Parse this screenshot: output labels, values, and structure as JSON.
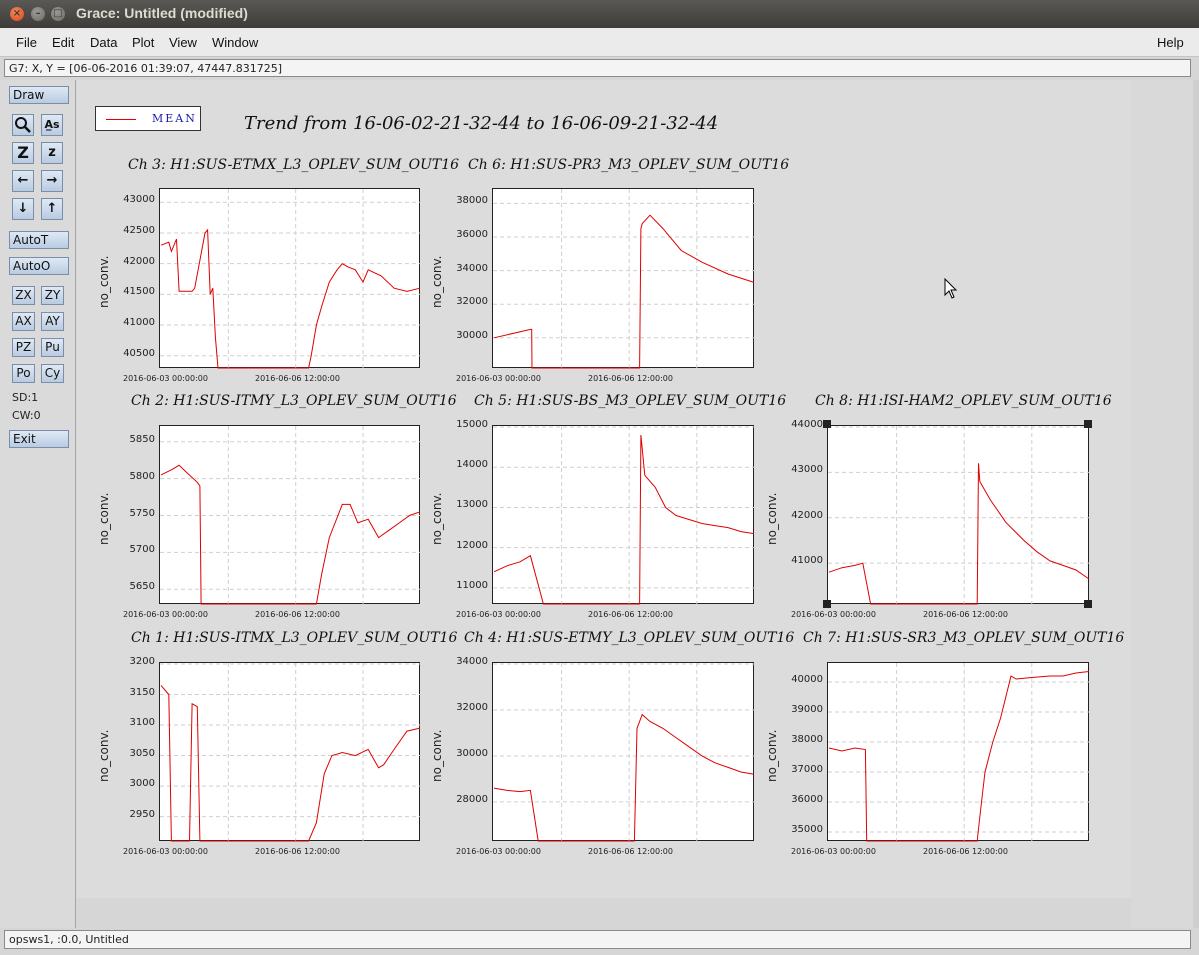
{
  "window": {
    "title": "Grace: Untitled (modified)"
  },
  "menu": {
    "file": "File",
    "edit": "Edit",
    "data": "Data",
    "plot": "Plot",
    "view": "View",
    "window": "Window",
    "help": "Help"
  },
  "locator": {
    "text": "G7: X, Y = [06-06-2016 01:39:07, 47447.831725]"
  },
  "toolbar": {
    "draw": "Draw",
    "autot": "AutoT",
    "autoo": "AutoO",
    "exit": "Exit",
    "zx": "ZX",
    "zy": "ZY",
    "ax": "AX",
    "ay": "AY",
    "pz": "PZ",
    "pu": "Pu",
    "po": "Po",
    "cy": "Cy",
    "sd": "SD:1",
    "cw": "CW:0",
    "z_big": "Z",
    "z_small": "z",
    "as": "A̲s"
  },
  "status": {
    "text": "opsws1, :0.0, Untitled"
  },
  "legend": {
    "label": "MEAN",
    "color": "#e00000"
  },
  "chart_title": "Trend from 16-06-02-21-32-44 to 16-06-09-21-32-44",
  "chart_data": [
    {
      "type": "line",
      "title": "Ch 3: H1:SUS-ETMX_L3_OPLEV_SUM_OUT16",
      "ylabel": "no_conv.",
      "ylim": [
        40300,
        43200
      ],
      "yticks": [
        40500,
        41000,
        41500,
        42000,
        42500,
        43000
      ],
      "xticks": [
        "2016-06-03 00:00:00",
        "2016-06-06 12:00:00"
      ],
      "x": [
        0,
        0.03,
        0.04,
        0.06,
        0.07,
        0.12,
        0.13,
        0.17,
        0.18,
        0.19,
        0.2,
        0.21,
        0.22,
        0.23,
        0.57,
        0.58,
        0.6,
        0.62,
        0.65,
        0.68,
        0.7,
        0.72,
        0.75,
        0.78,
        0.8,
        0.85,
        0.9,
        0.95,
        1.0
      ],
      "y": [
        42300,
        42350,
        42200,
        42400,
        41550,
        41550,
        41600,
        42500,
        42550,
        41500,
        41600,
        40800,
        40300,
        40300,
        40300,
        40500,
        41000,
        41300,
        41700,
        41900,
        42000,
        41950,
        41900,
        41700,
        41900,
        41800,
        41600,
        41550,
        41600
      ]
    },
    {
      "type": "line",
      "title": "Ch 6: H1:SUS-PR3_M3_OPLEV_SUM_OUT16",
      "ylabel": "no_conv.",
      "ylim": [
        28200,
        38800
      ],
      "yticks": [
        30000,
        32000,
        34000,
        36000,
        38000
      ],
      "xticks": [
        "2016-06-03 00:00:00",
        "2016-06-06 12:00:00"
      ],
      "x": [
        0,
        0.14,
        0.145,
        0.146,
        0.56,
        0.565,
        0.57,
        0.6,
        0.65,
        0.72,
        0.8,
        0.9,
        1.0
      ],
      "y": [
        30000,
        30500,
        30500,
        28200,
        28200,
        36500,
        36800,
        37300,
        36500,
        35200,
        34500,
        33800,
        33300
      ]
    },
    {
      "type": "line",
      "title": "Ch 2: H1:SUS-ITMY_L3_OPLEV_SUM_OUT16",
      "ylabel": "no_conv.",
      "ylim": [
        5630,
        5870
      ],
      "yticks": [
        5650,
        5700,
        5750,
        5800,
        5850
      ],
      "xticks": [
        "2016-06-03 00:00:00",
        "2016-06-06 12:00:00"
      ],
      "x": [
        0,
        0.04,
        0.07,
        0.1,
        0.14,
        0.15,
        0.155,
        0.6,
        0.62,
        0.65,
        0.7,
        0.73,
        0.76,
        0.8,
        0.84,
        0.88,
        0.92,
        0.96,
        1.0
      ],
      "y": [
        5805,
        5812,
        5818,
        5808,
        5795,
        5790,
        5630,
        5630,
        5670,
        5720,
        5765,
        5765,
        5740,
        5745,
        5720,
        5730,
        5740,
        5750,
        5755
      ]
    },
    {
      "type": "line",
      "title": "Ch 5: H1:SUS-BS_M3_OPLEV_SUM_OUT16",
      "ylabel": "no_conv.",
      "ylim": [
        10600,
        15000
      ],
      "yticks": [
        11000,
        12000,
        13000,
        14000,
        15000
      ],
      "xticks": [
        "2016-06-03 00:00:00",
        "2016-06-06 12:00:00"
      ],
      "x": [
        0,
        0.05,
        0.1,
        0.14,
        0.19,
        0.2,
        0.56,
        0.565,
        0.58,
        0.62,
        0.66,
        0.7,
        0.75,
        0.8,
        0.85,
        0.9,
        0.95,
        1.0
      ],
      "y": [
        11400,
        11550,
        11650,
        11800,
        10600,
        10600,
        10600,
        14800,
        13800,
        13500,
        13000,
        12800,
        12700,
        12600,
        12550,
        12500,
        12400,
        12350
      ]
    },
    {
      "type": "line",
      "title": "Ch 8: H1:ISI-HAM2_OPLEV_SUM_OUT16",
      "ylabel": "no_conv.",
      "ylim": [
        40100,
        44000
      ],
      "yticks": [
        41000,
        42000,
        43000,
        44000
      ],
      "xticks": [
        "2016-06-03 00:00:00",
        "2016-06-06 12:00:00"
      ],
      "x": [
        0,
        0.05,
        0.1,
        0.13,
        0.15,
        0.16,
        0.57,
        0.575,
        0.58,
        0.62,
        0.68,
        0.75,
        0.8,
        0.85,
        0.9,
        0.95,
        1.0
      ],
      "y": [
        40800,
        40900,
        40950,
        41000,
        40400,
        40100,
        40100,
        43200,
        42800,
        42400,
        41900,
        41500,
        41250,
        41050,
        40950,
        40850,
        40650
      ]
    },
    {
      "type": "line",
      "title": "Ch 1: H1:SUS-ITMX_L3_OPLEV_SUM_OUT16",
      "ylabel": "no_conv.",
      "ylim": [
        2910,
        3200
      ],
      "yticks": [
        2950,
        3000,
        3050,
        3100,
        3150,
        3200
      ],
      "xticks": [
        "2016-06-03 00:00:00",
        "2016-06-06 12:00:00"
      ],
      "x": [
        0,
        0.02,
        0.03,
        0.04,
        0.11,
        0.12,
        0.14,
        0.15,
        0.57,
        0.6,
        0.63,
        0.66,
        0.7,
        0.75,
        0.8,
        0.84,
        0.86,
        0.9,
        0.95,
        1.0
      ],
      "y": [
        3165,
        3155,
        3150,
        2910,
        2910,
        3135,
        3130,
        2910,
        2910,
        2940,
        3020,
        3050,
        3055,
        3050,
        3060,
        3030,
        3035,
        3060,
        3090,
        3095
      ]
    },
    {
      "type": "line",
      "title": "Ch 4: H1:SUS-ETMY_L3_OPLEV_SUM_OUT16",
      "ylabel": "no_conv.",
      "ylim": [
        26300,
        34000
      ],
      "yticks": [
        28000,
        30000,
        32000,
        34000
      ],
      "xticks": [
        "2016-06-03 00:00:00",
        "2016-06-06 12:00:00"
      ],
      "x": [
        0,
        0.05,
        0.1,
        0.14,
        0.17,
        0.18,
        0.54,
        0.55,
        0.57,
        0.6,
        0.65,
        0.7,
        0.75,
        0.8,
        0.85,
        0.9,
        0.95,
        1.0
      ],
      "y": [
        28600,
        28500,
        28450,
        28500,
        26300,
        26300,
        26300,
        31200,
        31800,
        31500,
        31200,
        30800,
        30400,
        30000,
        29700,
        29500,
        29300,
        29200
      ]
    },
    {
      "type": "line",
      "title": "Ch 7: H1:SUS-SR3_M3_OPLEV_SUM_OUT16",
      "ylabel": "no_conv.",
      "ylim": [
        34700,
        40600
      ],
      "yticks": [
        35000,
        36000,
        37000,
        38000,
        39000,
        40000
      ],
      "xticks": [
        "2016-06-03 00:00:00",
        "2016-06-06 12:00:00"
      ],
      "x": [
        0,
        0.05,
        0.1,
        0.14,
        0.145,
        0.57,
        0.58,
        0.6,
        0.63,
        0.66,
        0.68,
        0.7,
        0.72,
        0.78,
        0.85,
        0.9,
        0.95,
        1.0
      ],
      "y": [
        37800,
        37700,
        37800,
        37750,
        34700,
        34700,
        35500,
        37000,
        38000,
        38800,
        39500,
        40200,
        40100,
        40150,
        40200,
        40200,
        40300,
        40350
      ]
    }
  ]
}
